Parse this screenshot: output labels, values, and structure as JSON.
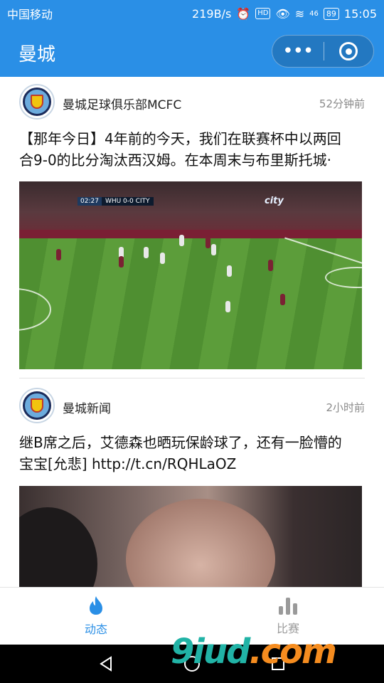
{
  "status_bar": {
    "carrier": "中国移动",
    "net_speed": "219B/s",
    "hd": "HD",
    "signal": "46",
    "battery": "89",
    "time": "15:05"
  },
  "header": {
    "title": "曼城",
    "more_icon": "more-dots-icon",
    "close_icon": "close-target-icon"
  },
  "posts": [
    {
      "author": "曼城足球俱乐部MCFC",
      "time": "52分钟前",
      "text_line1": "【那年今日】4年前的今天，我们在联赛杯中以两回",
      "text_line2": "合9-0的比分淘汰西汉姆。在本周末与布里斯托城·",
      "video_clock": "02:27",
      "video_score": "WHU 0-0 CITY",
      "video_ad": "city"
    },
    {
      "author": "曼城新闻",
      "time": "2小时前",
      "text_line1": "继B席之后，艾德森也晒玩保龄球了，还有一脸懵的",
      "text_line2": "宝宝[允悲] http://t.cn/RQHLaOZ"
    }
  ],
  "tabs": [
    {
      "label": "动态",
      "icon": "flame-icon",
      "active": true
    },
    {
      "label": "比赛",
      "icon": "bar-chart-icon",
      "active": false
    }
  ],
  "watermark": {
    "text": "9iud",
    "suffix": ".com"
  },
  "colors": {
    "accent": "#2a8fe6",
    "inactive": "#9a9a9a"
  }
}
